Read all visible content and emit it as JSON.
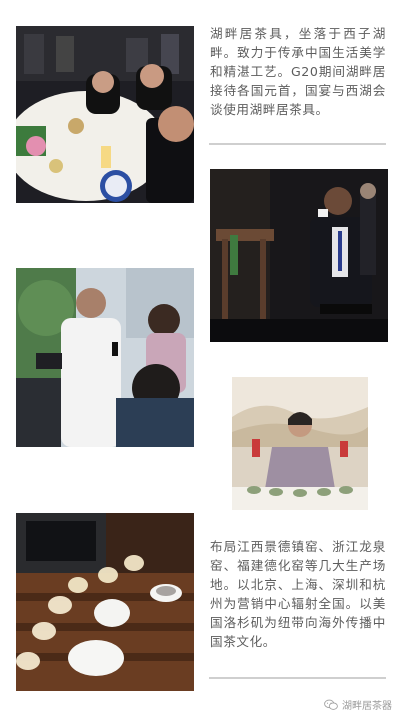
{
  "sections": {
    "intro_text": "湖畔居茶具，坐落于西子湖畔。致力于传承中国生活美学和精湛工艺。G20期间湖畔居接待各国元首，国宴与西湖会谈使用湖畔居茶具。",
    "bottom_text": "布局江西景德镇窑、浙江龙泉窑、福建德化窑等几大生产场地。以北京、上海、深圳和杭州为营销中心辐射全国。以美国洛杉矶为纽带向海外传播中国茶文化。"
  },
  "footer": {
    "account_name": "湖畔居茶器",
    "icon": "wechat-icon"
  },
  "colors": {
    "text": "#5d5d5d",
    "rule": "#cfcfcf",
    "footer_text": "#9a9a9a"
  }
}
